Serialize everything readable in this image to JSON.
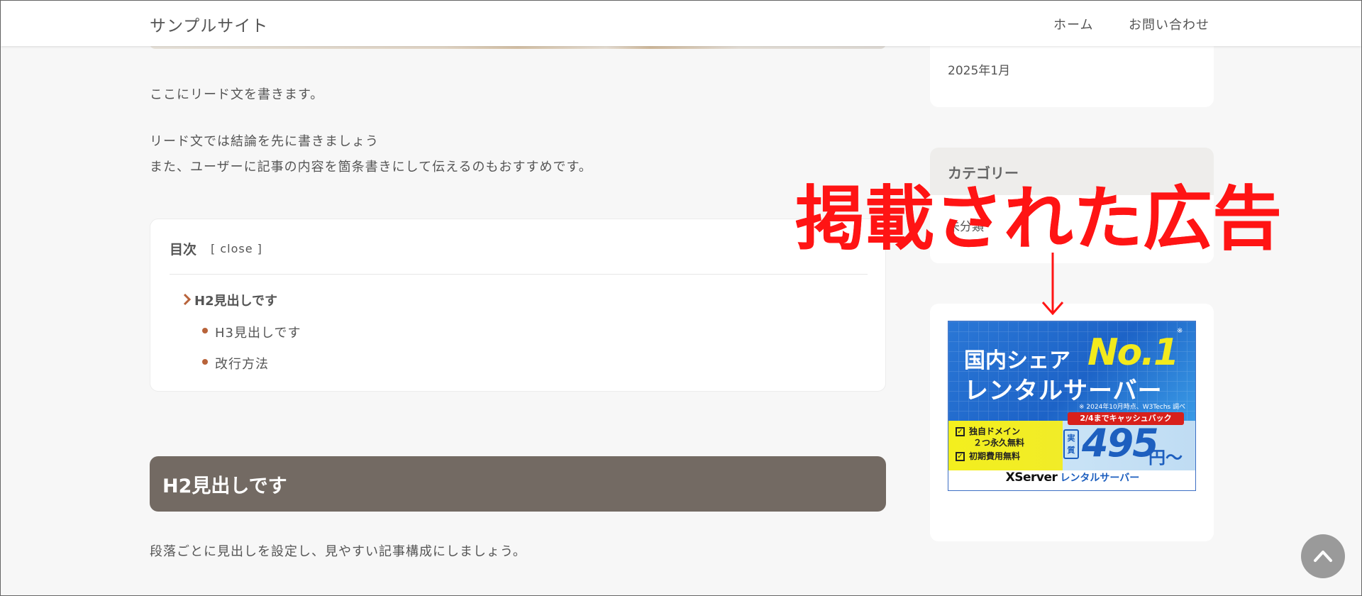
{
  "header": {
    "site_title": "サンプルサイト",
    "nav": [
      "ホーム",
      "お問い合わせ"
    ]
  },
  "main": {
    "lead": [
      "ここにリード文を書きます。",
      "リード文では結論を先に書きましょう",
      "また、ユーザーに記事の内容を箇条書きにして伝えるのもおすすめです。"
    ],
    "toc": {
      "title": "目次",
      "toggle": "[ close ]",
      "h2": "H2見出しです",
      "h3": [
        "H3見出しです",
        "改行方法"
      ]
    },
    "h2_heading": "H2見出しです",
    "paragraph": "段落ごとに見出しを設定し、見やすい記事構成にしましょう。"
  },
  "sidebar": {
    "archive_item": "2025年1月",
    "category_title": "カテゴリー",
    "category_item": "未分類",
    "ad": {
      "line1": "国内シェア",
      "no1": "No.1",
      "mark": "※",
      "line2": "レンタルサーバー",
      "note": "※ 2024年10月時点、W3Techs 調べ",
      "pill": "2/4までキャッシュバック",
      "check1a": "独自ドメイン",
      "check1b": "２つ永久無料",
      "check2": "初期費用無料",
      "jitsu": "実質",
      "price": "495",
      "yen": "円〜",
      "brand": "XServer",
      "brand_sub": "レンタルサーバー"
    }
  },
  "annotation": {
    "text": "掲載された広告"
  },
  "colors": {
    "h2_bar": "#736a63",
    "accent_bullet": "#b8633a",
    "annotation": "#ff1414"
  },
  "icons": {
    "toc_chevron": "chevron-right-icon",
    "back_to_top": "chevron-up-icon",
    "annotation_arrow": "arrow-down-icon"
  }
}
